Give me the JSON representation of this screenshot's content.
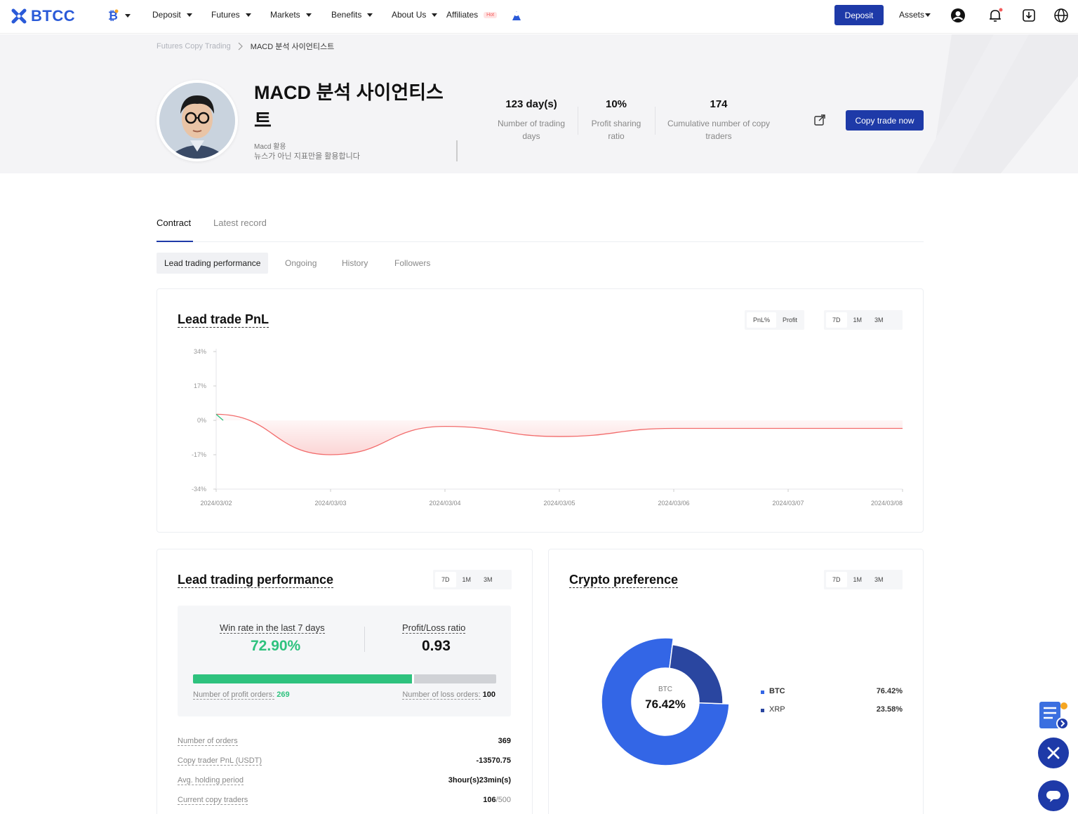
{
  "nav": {
    "logo": "BTCC",
    "items": [
      {
        "label": "Deposit",
        "caret": true
      },
      {
        "label": "Futures",
        "caret": true
      },
      {
        "label": "Markets",
        "caret": true
      },
      {
        "label": "Benefits",
        "caret": true
      },
      {
        "label": "About Us",
        "caret": true
      },
      {
        "label": "Affiliates",
        "caret": false
      }
    ],
    "hot_badge": "Hot",
    "deposit_button": "Deposit",
    "assets": "Assets"
  },
  "breadcrumb": {
    "parent": "Futures Copy Trading",
    "current": "MACD 분석 사이언티스트"
  },
  "trader": {
    "name": "MACD 분석 사이언티스트",
    "subtitle_line1": "Macd 활용",
    "subtitle_line2": "뉴스가 아닌 지표만을 활용합니다"
  },
  "stats": [
    {
      "value": "123 day(s)",
      "label": "Number of trading days"
    },
    {
      "value": "10%",
      "label": "Profit sharing ratio"
    },
    {
      "value": "174",
      "label": "Cumulative number of copy traders"
    }
  ],
  "copy_button": "Copy trade now",
  "tabs": [
    {
      "label": "Contract",
      "active": true
    },
    {
      "label": "Latest record",
      "active": false
    }
  ],
  "subtabs": [
    {
      "label": "Lead trading performance",
      "active": true
    },
    {
      "label": "Ongoing",
      "active": false
    },
    {
      "label": "History",
      "active": false
    },
    {
      "label": "Followers",
      "active": false
    }
  ],
  "pnl_card": {
    "title": "Lead trade PnL",
    "mode_options": [
      "PnL%",
      "Profit"
    ],
    "period_options": [
      "7D",
      "1M",
      "3M"
    ]
  },
  "chart_data": {
    "type": "line",
    "title": "Lead trade PnL",
    "x": [
      "2024/03/02",
      "2024/03/03",
      "2024/03/04",
      "2024/03/05",
      "2024/03/06",
      "2024/03/07",
      "2024/03/08"
    ],
    "y_ticks": [
      "34%",
      "17%",
      "0%",
      "-17%",
      "-34%"
    ],
    "ylim": [
      -34,
      34
    ],
    "series": [
      {
        "values": [
          3,
          -17,
          -3,
          -8,
          -4,
          -4,
          -4
        ]
      }
    ],
    "colors": {
      "negative": "#f26b6b",
      "positive": "#2ec27e"
    }
  },
  "performance_card": {
    "title": "Lead trading performance",
    "period_options": [
      "7D",
      "1M",
      "3M"
    ],
    "win_rate_label": "Win rate in the last 7 days",
    "win_rate": "72.90%",
    "pl_ratio_label": "Profit/Loss ratio",
    "pl_ratio": "0.93",
    "profit_fraction": 0.729,
    "profit_orders_label": "Number of profit orders:",
    "profit_orders": "269",
    "loss_orders_label": "Number of loss orders:",
    "loss_orders": "100",
    "rows": [
      {
        "label": "Number of orders",
        "value": "369"
      },
      {
        "label": "Copy trader PnL (USDT)",
        "value": "-13570.75"
      },
      {
        "label": "Avg. holding period",
        "value": "3hour(s)23min(s)"
      },
      {
        "label": "Current copy traders",
        "value": "106",
        "value_suffix": "/500"
      }
    ]
  },
  "crypto_card": {
    "title": "Crypto preference",
    "period_options": [
      "7D",
      "1M",
      "3M"
    ],
    "center_label": "BTC",
    "center_value": "76.42%",
    "legend": [
      {
        "name": "BTC",
        "percent": "76.42%",
        "value": 76.42,
        "color": "#3366e6"
      },
      {
        "name": "XRP",
        "percent": "23.58%",
        "value": 23.58,
        "color": "#2a46a0"
      }
    ]
  },
  "colors": {
    "brand": "#1e3aa8",
    "green": "#2ec27e",
    "red": "#f26b6b"
  }
}
